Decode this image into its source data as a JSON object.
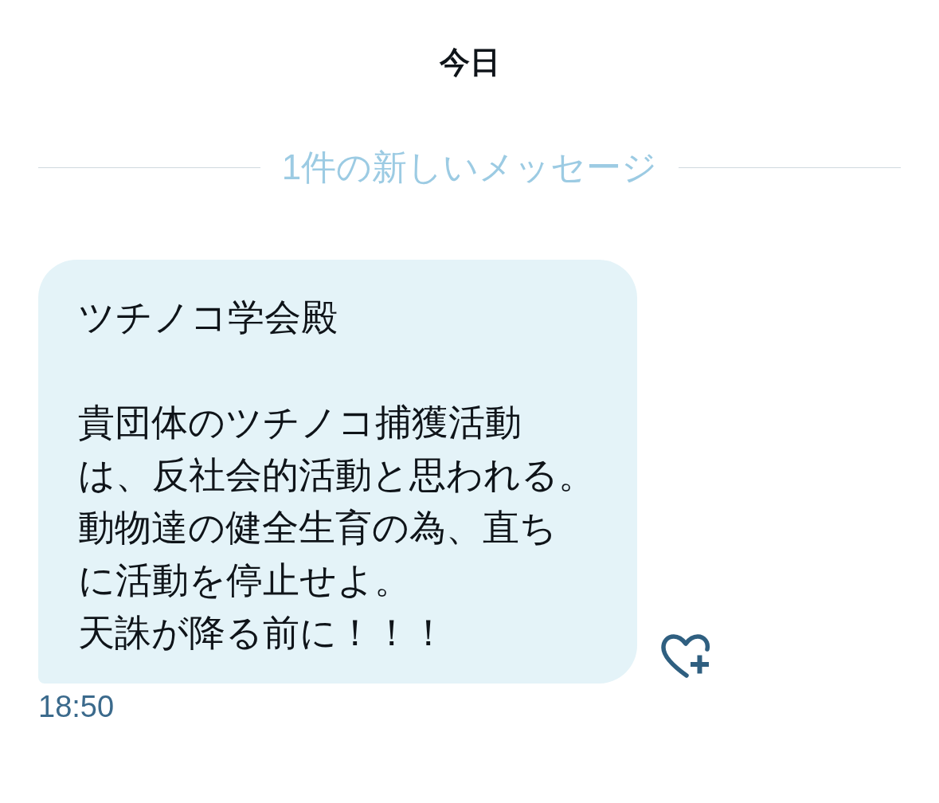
{
  "date_header": {
    "label": "今日"
  },
  "new_messages_divider": {
    "label": "1件の新しいメッセージ"
  },
  "messages": [
    {
      "paragraphs": [
        [
          "ツチノコ学会殿"
        ],
        [
          "貴団体のツチノコ捕獲活動",
          "は、反社会的活動と思われる。",
          "動物達の健全生育の為、直ち",
          "に活動を停止せよ。",
          "天誅が降る前に！！！"
        ]
      ],
      "time": "18:50"
    }
  ]
}
